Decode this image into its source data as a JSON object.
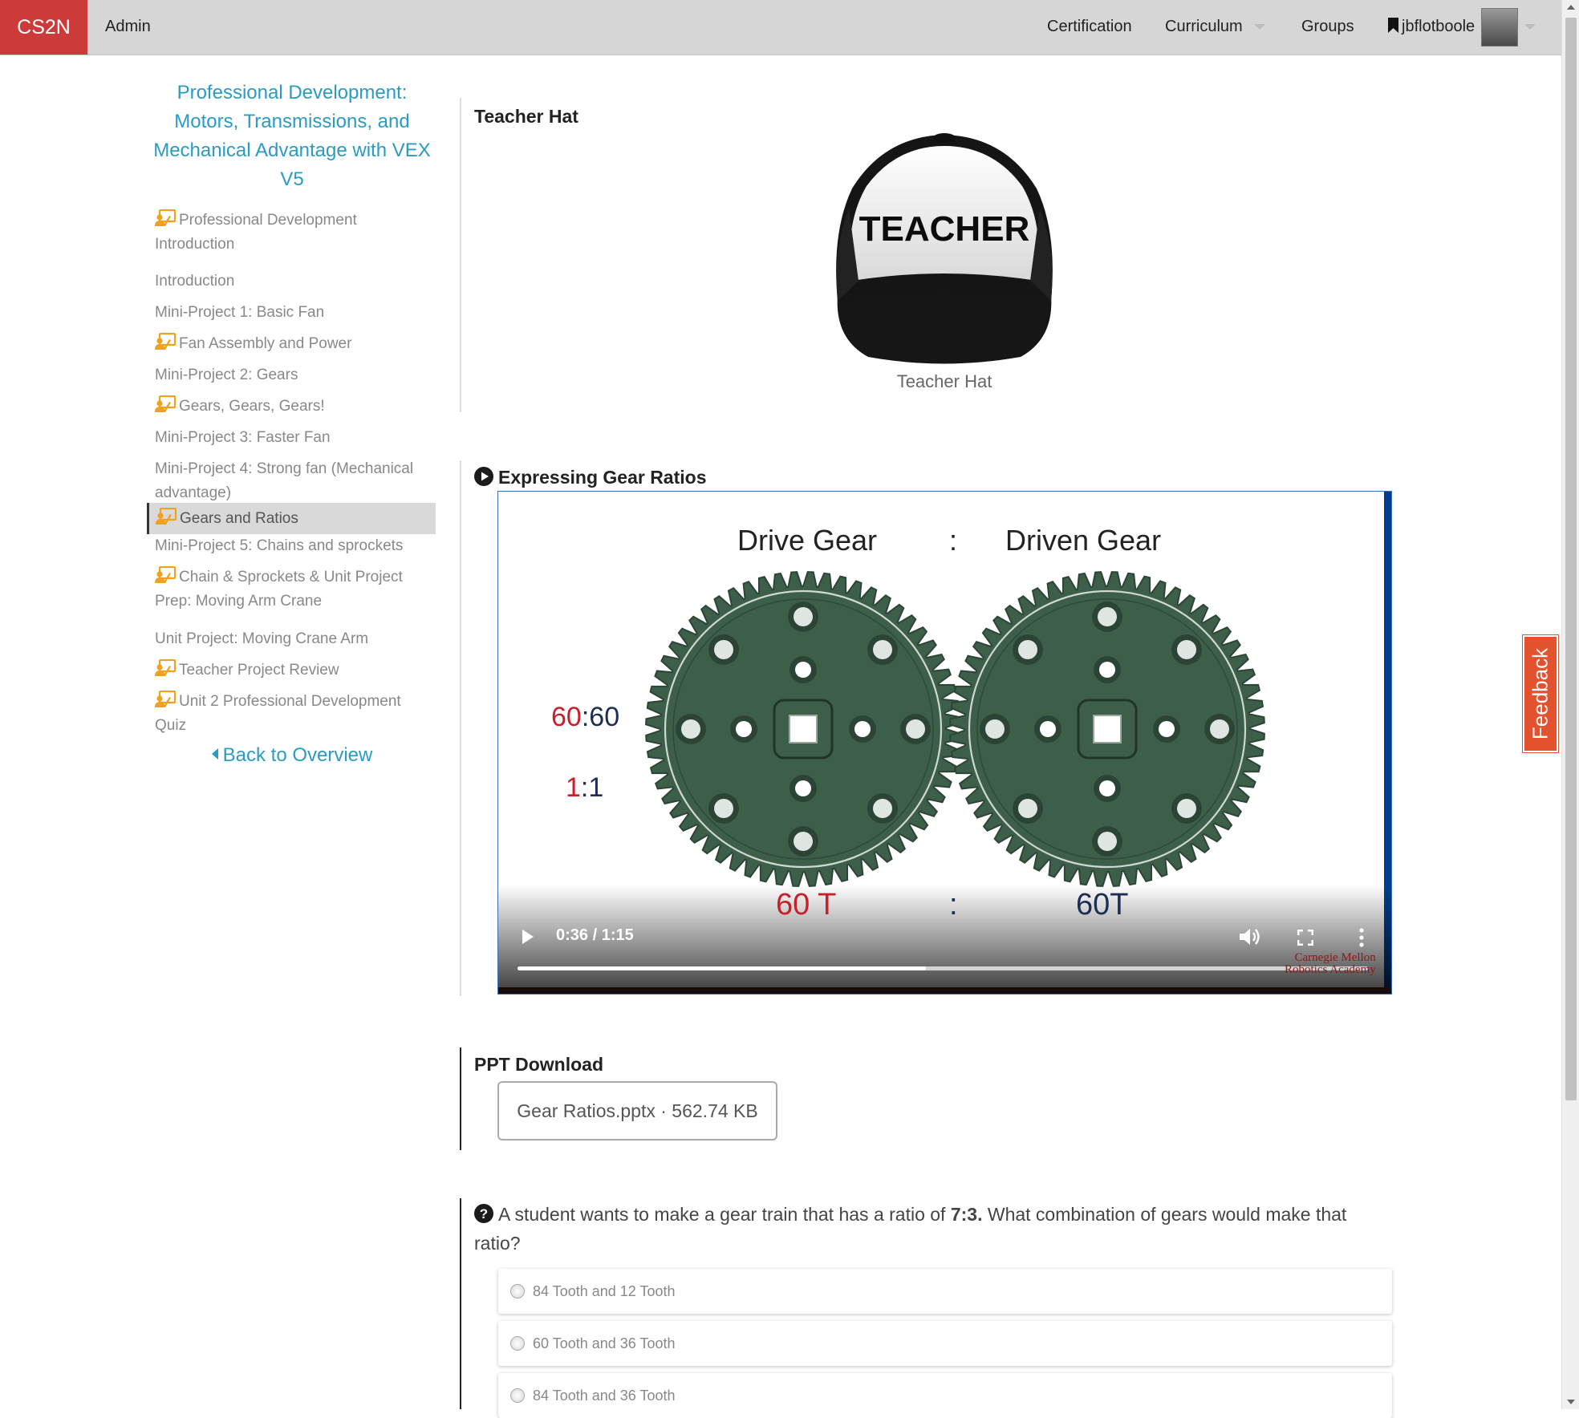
{
  "nav": {
    "brand": "CS2N",
    "admin": "Admin",
    "certification": "Certification",
    "curriculum": "Curriculum",
    "groups": "Groups",
    "username": "jbflotboole"
  },
  "sidebar": {
    "course_title": "Professional Development: Motors, Transmissions, and Mechanical Advantage with VEX V5",
    "items": [
      {
        "label": "Professional Development Introduction",
        "teacher": true
      },
      {
        "label": "Introduction",
        "teacher": false
      },
      {
        "label": "Mini-Project 1: Basic Fan",
        "teacher": false
      },
      {
        "label": "Fan Assembly and Power",
        "teacher": true
      },
      {
        "label": "Mini-Project 2: Gears",
        "teacher": false
      },
      {
        "label": "Gears, Gears, Gears!",
        "teacher": true
      },
      {
        "label": "Mini-Project 3: Faster Fan",
        "teacher": false
      },
      {
        "label": "Mini-Project 4: Strong fan (Mechanical advantage)",
        "teacher": false
      },
      {
        "label": "Gears and Ratios",
        "teacher": true,
        "active": true
      },
      {
        "label": "Mini-Project 5: Chains and sprockets",
        "teacher": false
      },
      {
        "label": "Chain & Sprockets & Unit Project Prep: Moving Arm Crane",
        "teacher": true
      },
      {
        "label": "Unit Project: Moving Crane Arm",
        "teacher": false
      },
      {
        "label": "Teacher Project Review",
        "teacher": true
      },
      {
        "label": "Unit 2 Professional Development Quiz",
        "teacher": true
      }
    ],
    "back_link": "Back to Overview"
  },
  "teacher_hat": {
    "title": "Teacher Hat",
    "hat_text": "TEACHER",
    "caption": "Teacher Hat"
  },
  "video": {
    "title": "Expressing Gear Ratios",
    "drive_label": "Drive Gear",
    "colon": ":",
    "driven_label": "Driven Gear",
    "ratio_a_left": "60",
    "ratio_a_sep": ":",
    "ratio_a_right": "60",
    "ratio_b_left": "1",
    "ratio_b_sep": ":",
    "ratio_b_right": "1",
    "drive_teeth": "60 T",
    "teeth_colon": ":",
    "driven_teeth": "60T",
    "time": "0:36 / 1:15",
    "played_fraction": 0.48,
    "buffered_fraction": 1.0,
    "watermark_line1": "Carnegie Mellon",
    "watermark_line2": "Robotics Academy",
    "gear_color": "#3d5e49"
  },
  "ppt": {
    "title": "PPT Download",
    "file_label": "Gear Ratios.pptx · 562.74 KB"
  },
  "question": {
    "text_before": "A student wants to make a gear train that has a ratio of ",
    "ratio": "7:3.",
    "text_after": " What combination of gears would make that ratio?",
    "options": [
      "84 Tooth and 12 Tooth",
      "60 Tooth and 36 Tooth",
      "84 Tooth and 36 Tooth"
    ]
  },
  "feedback": "Feedback",
  "colors": {
    "brand_red": "#cd3a3a",
    "link_blue": "#2a9bc4",
    "teacher_icon": "#f0a21f",
    "feedback": "#e2522f"
  }
}
